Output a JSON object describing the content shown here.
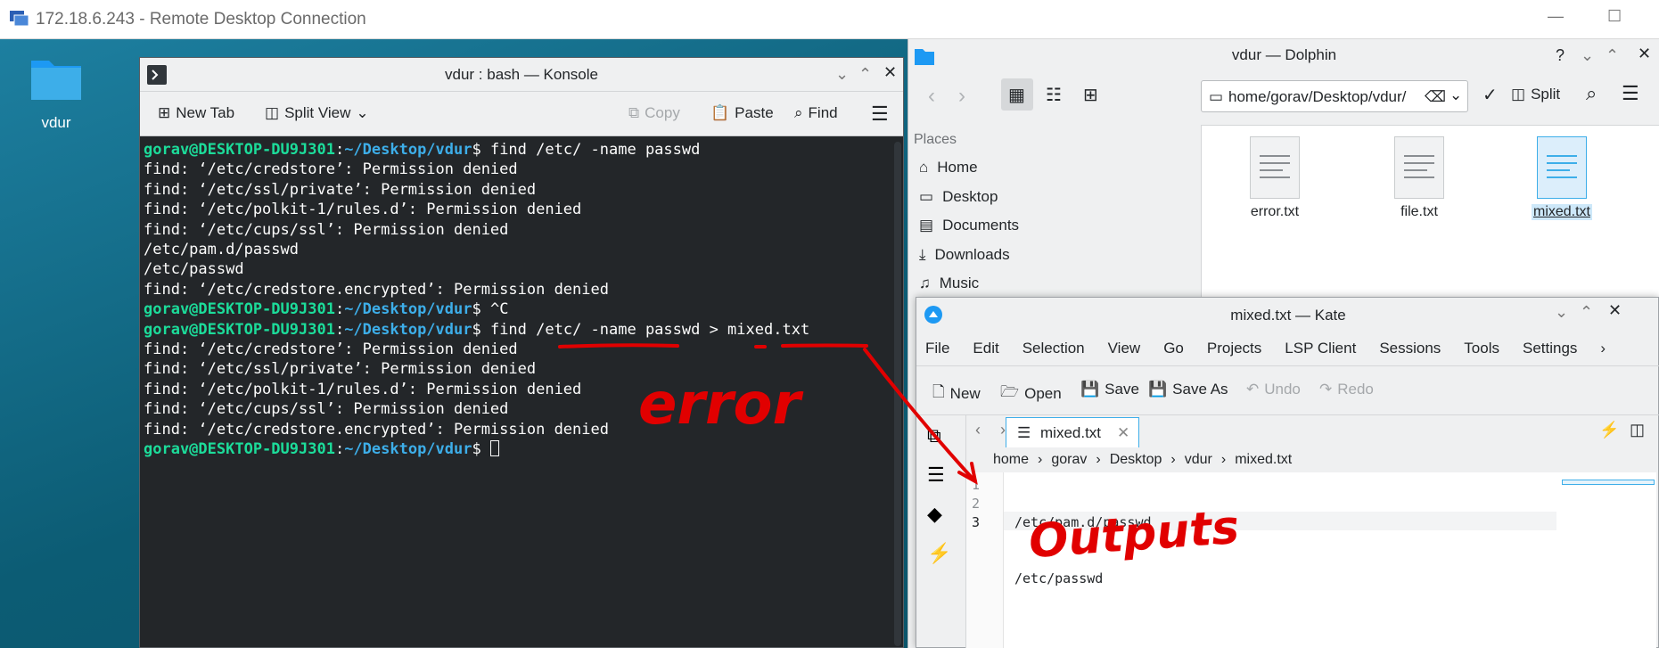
{
  "rdp": {
    "title": "172.18.6.243 - Remote Desktop Connection"
  },
  "desktop": {
    "folder_label": "vdur"
  },
  "konsole": {
    "title": "vdur : bash — Konsole",
    "toolbar": {
      "new_tab": "New Tab",
      "split_view": "Split View",
      "copy": "Copy",
      "paste": "Paste",
      "find": "Find"
    },
    "lines": [
      {
        "user": "gorav@DESKTOP-DU9J301",
        "path": "~/Desktop/vdur",
        "cmd": "$ find /etc/ -name passwd"
      },
      {
        "text": "find: ‘/etc/credstore’: Permission denied"
      },
      {
        "text": "find: ‘/etc/ssl/private’: Permission denied"
      },
      {
        "text": "find: ‘/etc/polkit-1/rules.d’: Permission denied"
      },
      {
        "text": "find: ‘/etc/cups/ssl’: Permission denied"
      },
      {
        "text": "/etc/pam.d/passwd"
      },
      {
        "text": "/etc/passwd"
      },
      {
        "text": "find: ‘/etc/credstore.encrypted’: Permission denied"
      },
      {
        "user": "gorav@DESKTOP-DU9J301",
        "path": "~/Desktop/vdur",
        "cmd": "$ ^C"
      },
      {
        "user": "gorav@DESKTOP-DU9J301",
        "path": "~/Desktop/vdur",
        "cmd": "$ find /etc/ -name passwd > mixed.txt"
      },
      {
        "text": "find: ‘/etc/credstore’: Permission denied"
      },
      {
        "text": "find: ‘/etc/ssl/private’: Permission denied"
      },
      {
        "text": "find: ‘/etc/polkit-1/rules.d’: Permission denied"
      },
      {
        "text": "find: ‘/etc/cups/ssl’: Permission denied"
      },
      {
        "text": "find: ‘/etc/credstore.encrypted’: Permission denied"
      },
      {
        "user": "gorav@DESKTOP-DU9J301",
        "path": "~/Desktop/vdur",
        "cmd": "$ "
      }
    ]
  },
  "dolphin": {
    "title": "vdur — Dolphin",
    "address": "home/gorav/Desktop/vdur/",
    "split": "Split",
    "places_header": "Places",
    "places": [
      "Home",
      "Desktop",
      "Documents",
      "Downloads",
      "Music"
    ],
    "files": [
      "error.txt",
      "file.txt",
      "mixed.txt"
    ]
  },
  "kate": {
    "title": "mixed.txt — Kate",
    "menu": [
      "File",
      "Edit",
      "Selection",
      "View",
      "Go",
      "Projects",
      "LSP Client",
      "Sessions",
      "Tools",
      "Settings"
    ],
    "toolbar": {
      "new": "New",
      "open": "Open",
      "save": "Save",
      "save_as": "Save As",
      "undo": "Undo",
      "redo": "Redo"
    },
    "tab": "mixed.txt",
    "breadcrumb": [
      "home",
      "gorav",
      "Desktop",
      "vdur",
      "mixed.txt"
    ],
    "line_numbers": [
      "1",
      "2",
      "3"
    ],
    "code": [
      "/etc/pam.d/passwd",
      "/etc/passwd",
      ""
    ]
  },
  "annotations": {
    "error": "error",
    "outputs": "Outputs",
    "color": "#e10000"
  }
}
